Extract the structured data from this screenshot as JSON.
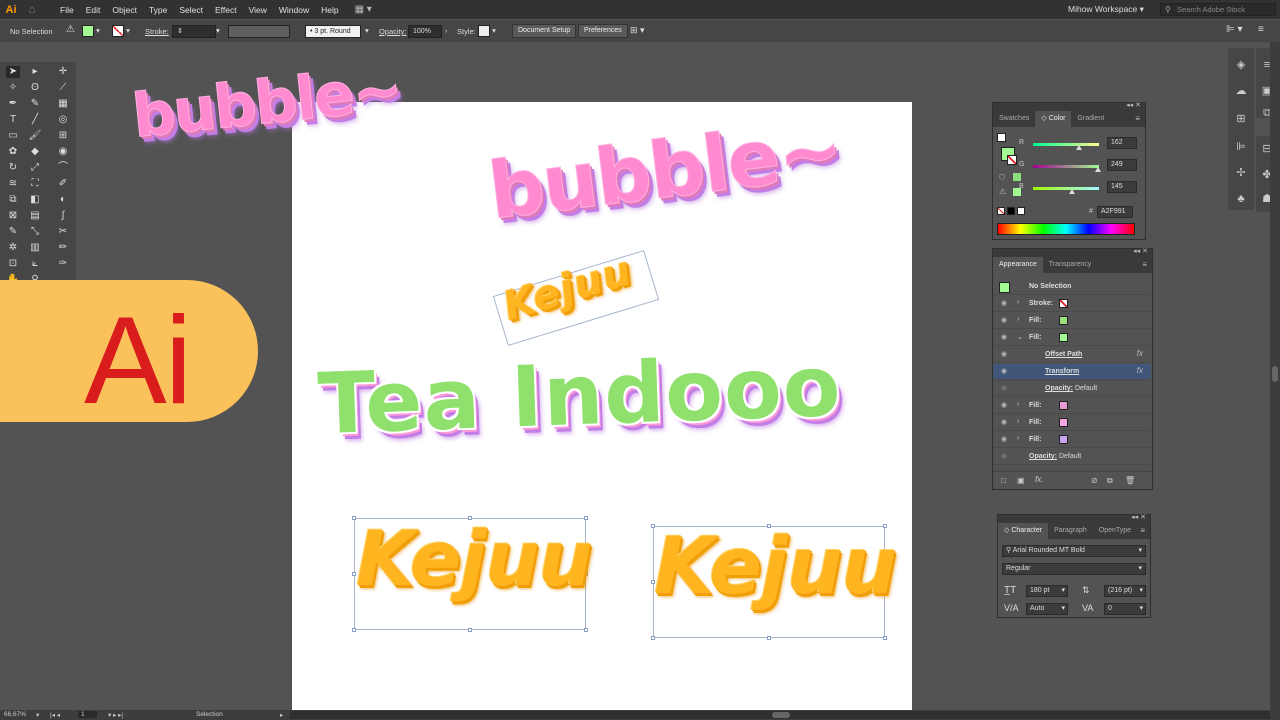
{
  "app": {
    "logo": "Ai",
    "workspace": "Mihow Workspace",
    "search_placeholder": "Search Adobe Stock"
  },
  "menu": [
    "File",
    "Edit",
    "Object",
    "Type",
    "Select",
    "Effect",
    "View",
    "Window",
    "Help"
  ],
  "control": {
    "selection": "No Selection",
    "stroke_label": "Stroke:",
    "brush": "3 pt. Round",
    "opacity_label": "Opacity:",
    "opacity_value": "100%",
    "style_label": "Style:",
    "doc_setup": "Document Setup",
    "preferences": "Preferences"
  },
  "badge": {
    "text": "Ai"
  },
  "artwork": {
    "bubble_small": "bubble~",
    "bubble_large": "bubble~",
    "kejuu_rotated": "Kejuu",
    "tea": "Tea Indooo",
    "kejuu_left": "Kejuu",
    "kejuu_right": "Kejuu"
  },
  "color_panel": {
    "tabs": [
      "Swatches",
      "Color",
      "Gradient"
    ],
    "active_tab": "Color",
    "r_label": "R",
    "r": "162",
    "g_label": "G",
    "g": "249",
    "b_label": "B",
    "b": "145",
    "hash": "#",
    "hex": "A2F991"
  },
  "appearance_panel": {
    "tabs": [
      "Appearance",
      "Transparency"
    ],
    "header": "No Selection",
    "rows": [
      {
        "label": "Stroke:",
        "kind": "stroke"
      },
      {
        "label": "Fill:",
        "kind": "fill",
        "color": "#9be07a"
      },
      {
        "label": "Fill:",
        "kind": "fill",
        "color": "#a2f991",
        "expanded": true
      },
      {
        "label": "Offset Path",
        "kind": "effect"
      },
      {
        "label": "Transform",
        "kind": "effect",
        "selected": true
      },
      {
        "label": "Opacity:",
        "value": "Default",
        "kind": "opacity"
      },
      {
        "label": "Fill:",
        "kind": "fill",
        "color": "#e59ad6"
      },
      {
        "label": "Fill:",
        "kind": "fill",
        "color": "#f2a6e2"
      },
      {
        "label": "Fill:",
        "kind": "fill",
        "color": "#c9a2f0"
      },
      {
        "label": "Opacity:",
        "value": "Default",
        "kind": "opacity"
      }
    ],
    "fx": "fx"
  },
  "character_panel": {
    "tabs": [
      "Character",
      "Paragraph",
      "OpenType"
    ],
    "font": "Arial Rounded MT Bold",
    "style": "Regular",
    "size": "180 pt",
    "leading": "(216 pt)",
    "kerning": "Auto",
    "tracking": "0"
  },
  "status": {
    "zoom": "66,67%",
    "page": "1",
    "tool": "Selection"
  }
}
